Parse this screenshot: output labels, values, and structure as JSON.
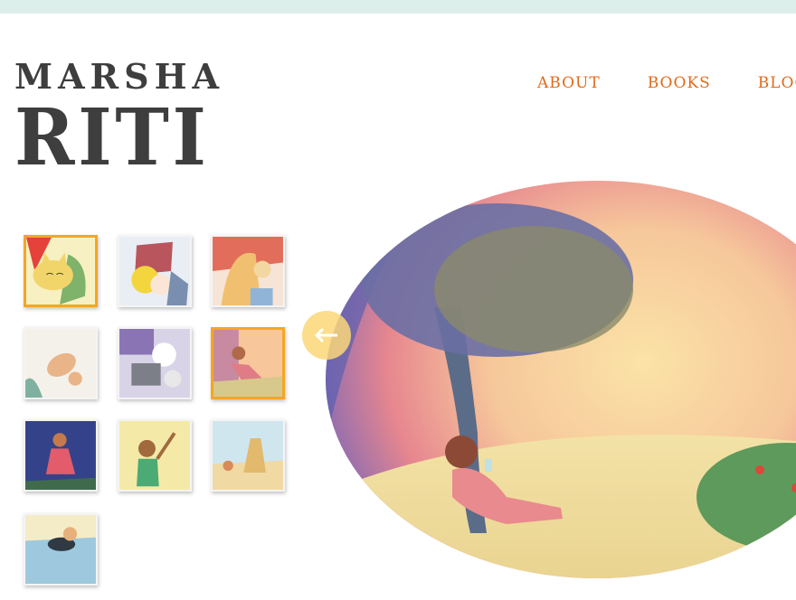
{
  "header": {
    "logo_first": "MARSHA",
    "logo_last": "RITI"
  },
  "nav": {
    "items": [
      {
        "label": "ABOUT"
      },
      {
        "label": "BOOKS"
      },
      {
        "label": "BLOG"
      }
    ],
    "color": "#e06a1a"
  },
  "gallery": {
    "thumbnails": [
      {
        "name": "cat-illustration",
        "selected": true
      },
      {
        "name": "gnome-illustration",
        "selected": false
      },
      {
        "name": "giraffe-illustration",
        "selected": false
      },
      {
        "name": "dog-illustration",
        "selected": false
      },
      {
        "name": "robot-illustration",
        "selected": false
      },
      {
        "name": "girl-under-tree-illustration",
        "selected": true
      },
      {
        "name": "girl-dancing-illustration",
        "selected": false
      },
      {
        "name": "boy-rain-illustration",
        "selected": false
      },
      {
        "name": "sandcastle-illustration",
        "selected": false
      },
      {
        "name": "swimmer-illustration",
        "selected": false
      }
    ],
    "selected_border_color": "#f5a623"
  },
  "hero": {
    "name": "girl-under-tree-artwork",
    "prev_icon": "arrow-left-icon"
  },
  "colors": {
    "top_bar": "#dcefeb",
    "logo_text": "#3e3e3e"
  }
}
